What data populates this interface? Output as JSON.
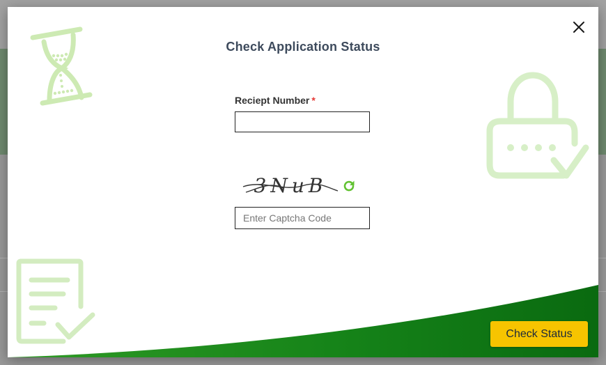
{
  "modal": {
    "title": "Check Application Status",
    "close_icon": "close-icon"
  },
  "form": {
    "receipt_label": "Reciept Number",
    "required_mark": "*",
    "receipt_value": "",
    "captcha_text": "3NuB",
    "captcha_placeholder": "Enter Captcha Code",
    "captcha_value": "",
    "refresh_icon": "refresh-icon"
  },
  "actions": {
    "check_status_label": "Check Status"
  },
  "decorations": {
    "top_left": "hourglass-icon",
    "top_right": "padlock-check-icon",
    "bottom_left": "checklist-icon"
  },
  "colors": {
    "accent_green": "#0f7a14",
    "button_yellow": "#f7c400",
    "title_color": "#3d4a5c",
    "deco_green": "#cdeab3",
    "required_red": "#e53935"
  }
}
